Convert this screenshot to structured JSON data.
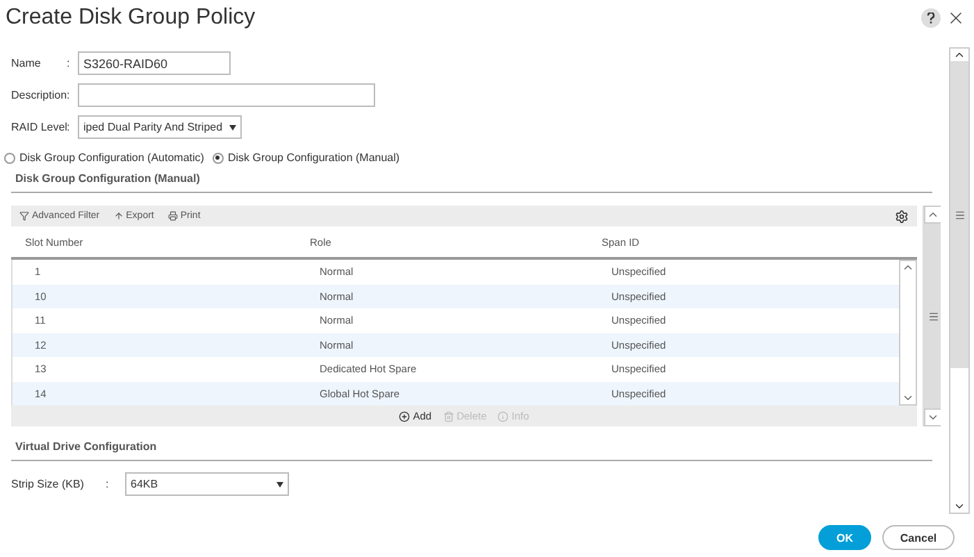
{
  "window": {
    "title": "Create Disk Group Policy"
  },
  "form": [
    {
      "label": "Name",
      "separator": ":",
      "value": "S3260-RAID60",
      "kind": "text"
    },
    {
      "label": "Description",
      "separator": ":",
      "kind": "text"
    },
    {
      "label": "RAID Level",
      "separator": ":",
      "value": "iped Dual Parity And Striped",
      "kind": "select"
    }
  ],
  "config_modes": [
    {
      "label": "Disk Group Configuration (Automatic)",
      "selected": false
    },
    {
      "label": "Disk Group Configuration (Manual)",
      "selected": true
    }
  ],
  "disk_group": {
    "title": "Disk Group Configuration (Manual)",
    "toolbar": [
      "Advanced Filter",
      "Export",
      "Print"
    ],
    "table": {
      "columns": [
        "Slot Number",
        "Role",
        "Span ID"
      ],
      "rows": [
        [
          "1",
          "Normal",
          "Unspecified"
        ],
        [
          "10",
          "Normal",
          "Unspecified"
        ],
        [
          "11",
          "Normal",
          "Unspecified"
        ],
        [
          "12",
          "Normal",
          "Unspecified"
        ],
        [
          "13",
          "Dedicated Hot Spare",
          "Unspecified"
        ],
        [
          "14",
          "Global Hot Spare",
          "Unspecified"
        ]
      ]
    },
    "actions": [
      {
        "label": "Add",
        "disabled": false
      },
      {
        "label": "Delete",
        "disabled": true
      },
      {
        "label": "Info",
        "disabled": true
      }
    ]
  },
  "virtual_drive": {
    "title": "Virtual Drive Configuration",
    "fields": [
      {
        "label": "Strip Size (KB)",
        "separator": ":",
        "value": "64KB"
      }
    ]
  },
  "buttons": [
    {
      "label": "OK",
      "kind": "primary"
    },
    {
      "label": "Cancel",
      "kind": "secondary"
    }
  ]
}
